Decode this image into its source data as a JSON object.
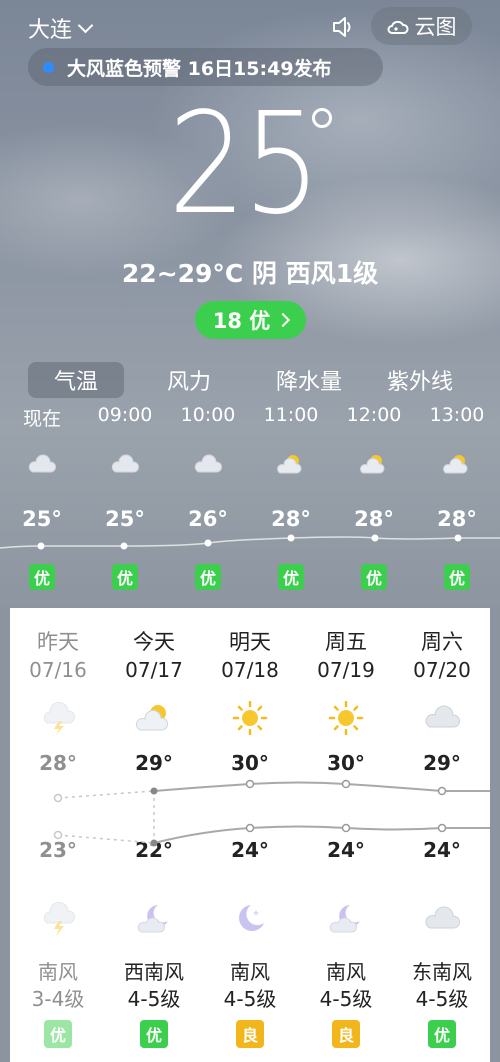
{
  "header": {
    "city": "大连",
    "cloud_map_label": "云图",
    "alert_text": "大风蓝色预警 16日15:49发布"
  },
  "current": {
    "temp": "25",
    "summary": "22~29°C 阴 西风1级",
    "aqi": "18 优"
  },
  "tabs": [
    "气温",
    "风力",
    "降水量",
    "紫外线"
  ],
  "hourly": [
    {
      "time": "现在",
      "icon": "cloud-icon",
      "temp": "25°",
      "aqi": "优"
    },
    {
      "time": "09:00",
      "icon": "cloud-icon",
      "temp": "25°",
      "aqi": "优"
    },
    {
      "time": "10:00",
      "icon": "cloud-icon",
      "temp": "26°",
      "aqi": "优"
    },
    {
      "time": "11:00",
      "icon": "partly-cloudy-icon",
      "temp": "28°",
      "aqi": "优"
    },
    {
      "time": "12:00",
      "icon": "partly-cloudy-icon",
      "temp": "28°",
      "aqi": "优"
    },
    {
      "time": "13:00",
      "icon": "partly-cloudy-icon",
      "temp": "28°",
      "aqi": "优"
    }
  ],
  "daily": [
    {
      "name": "昨天",
      "date": "07/16",
      "icon": "thunderstorm-icon",
      "high": "28°",
      "low": "23°",
      "night_icon": "thunderstorm-icon",
      "wind": "南风",
      "level": "3-4级",
      "aqi": "优",
      "aqi_color": "#3ccf4e"
    },
    {
      "name": "今天",
      "date": "07/17",
      "icon": "partly-cloudy-icon",
      "high": "29°",
      "low": "22°",
      "night_icon": "cloudy-moon-icon",
      "wind": "西南风",
      "level": "4-5级",
      "aqi": "优",
      "aqi_color": "#3ccf4e"
    },
    {
      "name": "明天",
      "date": "07/18",
      "icon": "sun-icon",
      "high": "30°",
      "low": "24°",
      "night_icon": "moon-icon",
      "wind": "南风",
      "level": "4-5级",
      "aqi": "良",
      "aqi_color": "#f2b51c"
    },
    {
      "name": "周五",
      "date": "07/19",
      "icon": "sun-icon",
      "high": "30°",
      "low": "24°",
      "night_icon": "cloudy-moon-icon",
      "wind": "南风",
      "level": "4-5级",
      "aqi": "良",
      "aqi_color": "#f2b51c"
    },
    {
      "name": "周六",
      "date": "07/20",
      "icon": "cloud-icon",
      "high": "29°",
      "low": "24°",
      "night_icon": "cloud-icon",
      "wind": "东南风",
      "level": "4-5级",
      "aqi": "优",
      "aqi_color": "#3ccf4e"
    }
  ]
}
